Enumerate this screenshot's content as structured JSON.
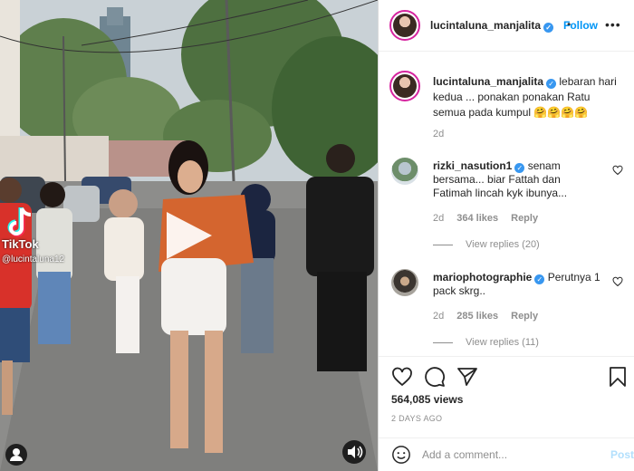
{
  "media": {
    "watermark_app": "TikTok",
    "watermark_user": "@lucintaluna12",
    "icons": [
      "play-icon",
      "tiktok-logo-icon",
      "user-tag-icon",
      "sound-icon"
    ]
  },
  "header": {
    "username": "lucintaluna_manjalita",
    "separator": "•",
    "follow_label": "Follow",
    "more_label": "•••"
  },
  "caption": {
    "username": "lucintaluna_manjalita",
    "text": "lebaran hari kedua ... ponakan ponakan Ratu semua pada kumpul 🤗🤗🤗🤗",
    "time": "2d"
  },
  "comments": [
    {
      "username": "rizki_nasution1",
      "text": "senam bersama... biar Fattah dan Fatimah lincah kyk ibunya...",
      "time": "2d",
      "likes": "364 likes",
      "reply_label": "Reply",
      "view_replies": "View replies (20)"
    },
    {
      "username": "mariophotographie",
      "text": "Perutnya 1 pack skrg..",
      "time": "2d",
      "likes": "285 likes",
      "reply_label": "Reply",
      "view_replies": "View replies (11)"
    }
  ],
  "actions": {
    "views": "564,085 views",
    "posted": "2 DAYS AGO"
  },
  "add_comment": {
    "placeholder": "Add a comment...",
    "post_label": "Post"
  },
  "colors": {
    "accent": "#0095f6",
    "verified": "#3897f0",
    "post_disabled": "#b2dffc",
    "secondary_text": "#8e8e8e",
    "divider": "#efefef"
  }
}
